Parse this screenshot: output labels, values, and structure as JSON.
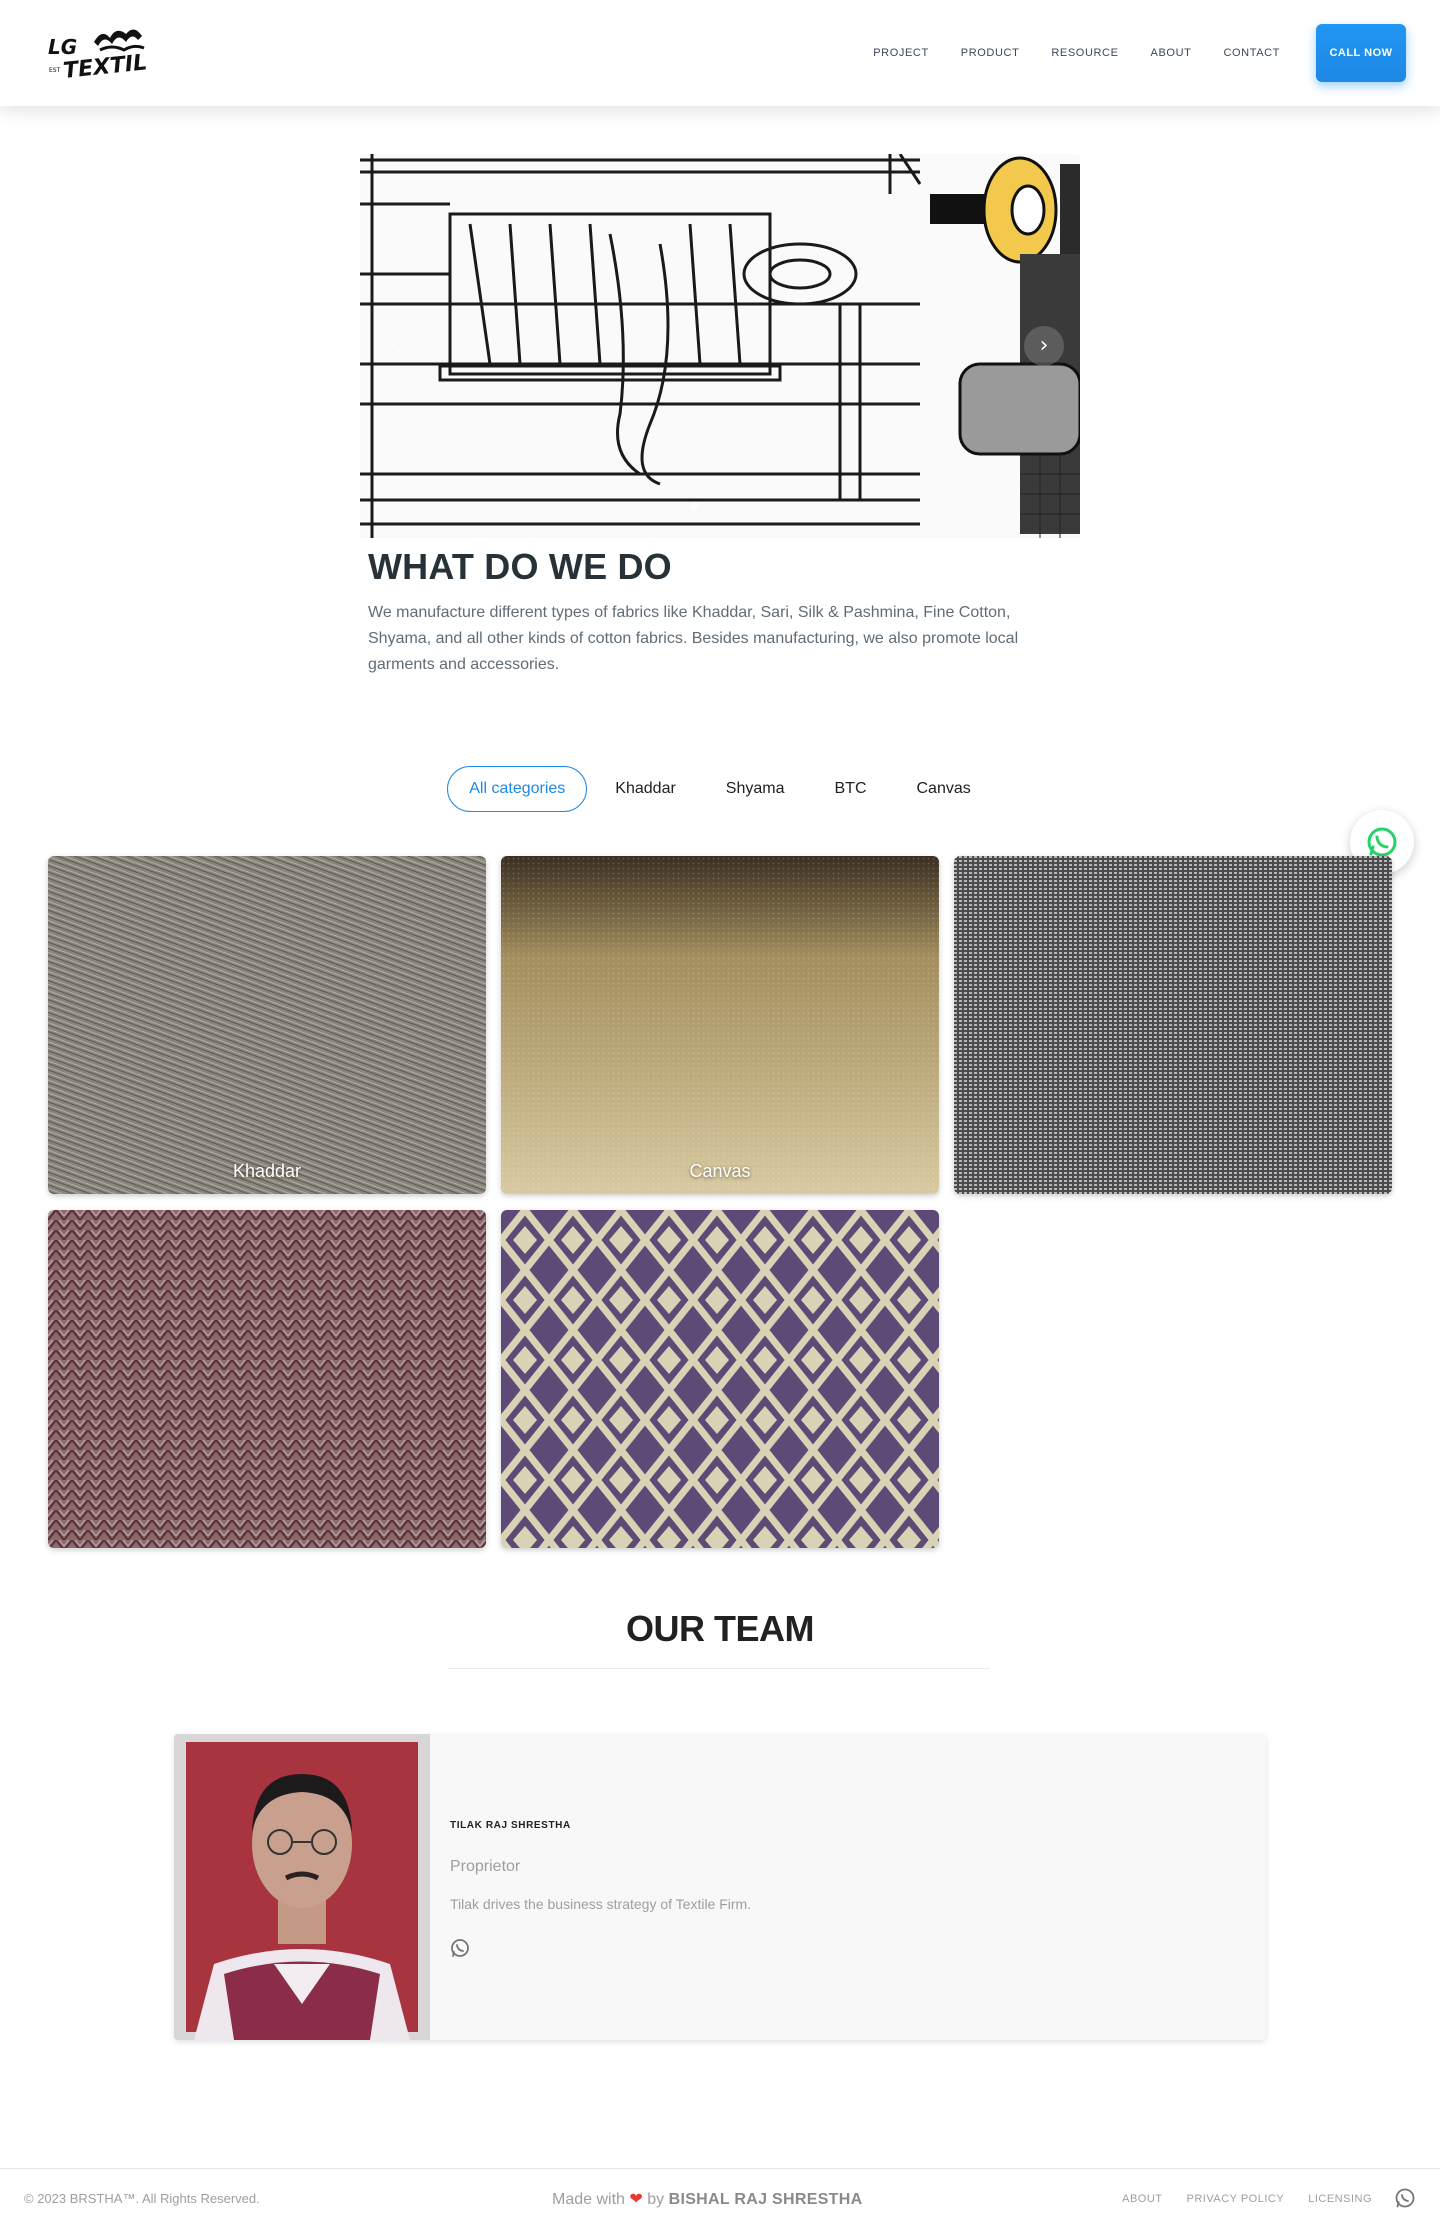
{
  "brand": {
    "logo_alt": "LG Textile"
  },
  "nav": {
    "items": [
      {
        "label": "PROJECT"
      },
      {
        "label": "PRODUCT"
      },
      {
        "label": "RESOURCE"
      },
      {
        "label": "ABOUT"
      },
      {
        "label": "CONTACT"
      }
    ],
    "call_label": "CALL NOW"
  },
  "carousel": {
    "next_icon": "chevron-right-icon",
    "prev_icon": "chevron-left-icon"
  },
  "what": {
    "title": "WHAT DO WE DO",
    "text": "We manufacture different types of fabrics like Khaddar, Sari, Silk & Pashmina, Fine Cotton, Shyama, and all other kinds of cotton fabrics. Besides manufacturing, we also promote local garments and accessories."
  },
  "filters": [
    {
      "label": "All categories",
      "active": true
    },
    {
      "label": "Khaddar",
      "active": false
    },
    {
      "label": "Shyama",
      "active": false
    },
    {
      "label": "BTC",
      "active": false
    },
    {
      "label": "Canvas",
      "active": false
    }
  ],
  "gallery": [
    {
      "caption": "Khaddar",
      "color": "#8a857c"
    },
    {
      "caption": "Canvas",
      "color": "#c9b98c"
    },
    {
      "caption": "",
      "color": "#6b6a6c"
    },
    {
      "caption": "",
      "color": "#7d5a5e"
    },
    {
      "caption": "",
      "color": "#6d5a80"
    }
  ],
  "team": {
    "title": "OUR TEAM",
    "members": [
      {
        "name": "TILAK RAJ SHRESTHA",
        "role": "Proprietor",
        "description": "Tilak drives the business strategy of Textile Firm."
      }
    ]
  },
  "footer": {
    "copyright": "© 2023 BRSTHA™. All Rights Reserved.",
    "made_with": "Made with",
    "by": "by",
    "author": "BISHAL RAJ SHRESTHA",
    "links": [
      {
        "label": "ABOUT"
      },
      {
        "label": "PRIVACY POLICY"
      },
      {
        "label": "LICENSING"
      }
    ]
  },
  "colors": {
    "accent": "#1e88e5",
    "whatsapp": "#25d366",
    "heart": "#e53935"
  }
}
